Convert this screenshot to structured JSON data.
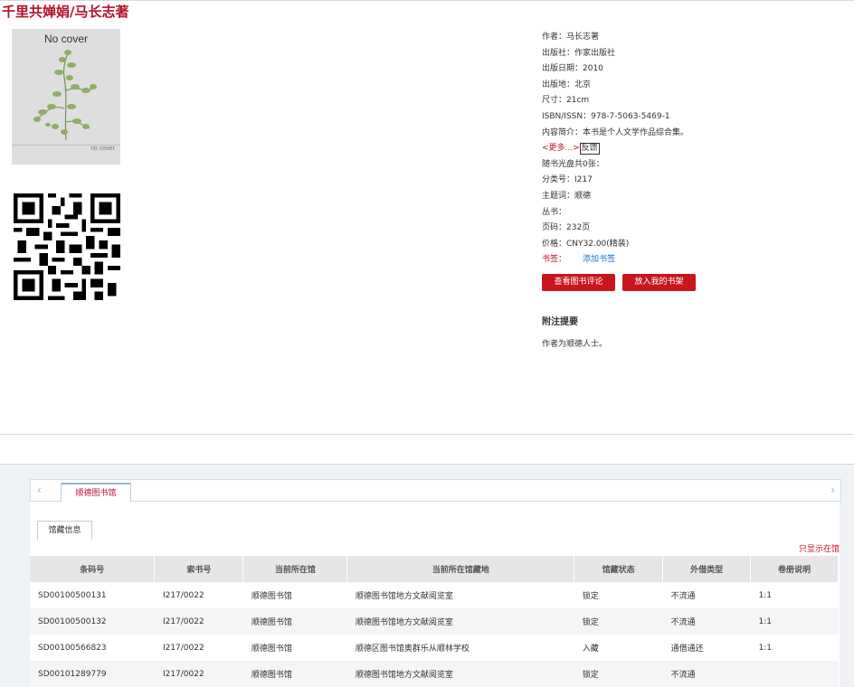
{
  "book": {
    "title": "千里共婵娟/马长志著"
  },
  "cover": {
    "label": "No cover",
    "small_label": "no cover"
  },
  "info": [
    {
      "text": "作者：马长志著"
    },
    {
      "text": "出版社：作家出版社"
    },
    {
      "text": "出版日期：2010"
    },
    {
      "text": "出版地：北京"
    },
    {
      "text": "尺寸：21cm"
    },
    {
      "text": "ISBN/ISSN：978-7-5063-5469-1"
    },
    {
      "text": "内容简介：本书是个人文学作品综合集。"
    }
  ],
  "more": {
    "label": "<更多...>",
    "feedback": "反馈"
  },
  "info2": [
    {
      "text": "随书光盘共0张："
    },
    {
      "text": "分类号：I217"
    },
    {
      "text": "主题词：顺德"
    },
    {
      "text": "丛书："
    },
    {
      "text": "页码：232页"
    },
    {
      "text": "价格：CNY32.00(精装)"
    }
  ],
  "bookmark": {
    "label": "书签：",
    "add": "添加书签"
  },
  "buttons": {
    "review": "查看图书评论",
    "shelf": "放入我的书架"
  },
  "note": {
    "heading": "附注提要",
    "text": "作者为顺德人士。"
  },
  "tabs": {
    "library": "顺德图书馆",
    "sub": "馆藏信息",
    "only": "只显示在馆",
    "left_arrow": "‹",
    "right_arrow": "›"
  },
  "table": {
    "headers": [
      "条码号",
      "索书号",
      "当前所在馆",
      "当前所在馆藏地",
      "馆藏状态",
      "外借类型",
      "卷册说明"
    ],
    "rows": [
      [
        "SD00100500131",
        "I217/0022",
        "顺德图书馆",
        "顺德图书馆地方文献阅览室",
        "锁定",
        "不流通",
        "1:1"
      ],
      [
        "SD00100500132",
        "I217/0022",
        "顺德图书馆",
        "顺德图书馆地方文献阅览室",
        "锁定",
        "不流通",
        "1:1"
      ],
      [
        "SD00100566823",
        "I217/0022",
        "顺德图书馆",
        "顺德区图书馆奥群乐从顺林学校",
        "入藏",
        "通借通还",
        "1:1"
      ],
      [
        "SD00101289779",
        "I217/0022",
        "顺德图书馆",
        "顺德图书馆地方文献阅览室",
        "锁定",
        "不流通",
        ""
      ]
    ]
  },
  "colors": {
    "accent": "#c8102e",
    "button": "#c8161d",
    "link": "#1b6fc6"
  },
  "icons": {
    "qr": "qr-code-icon",
    "cover": "plant-illustration"
  }
}
